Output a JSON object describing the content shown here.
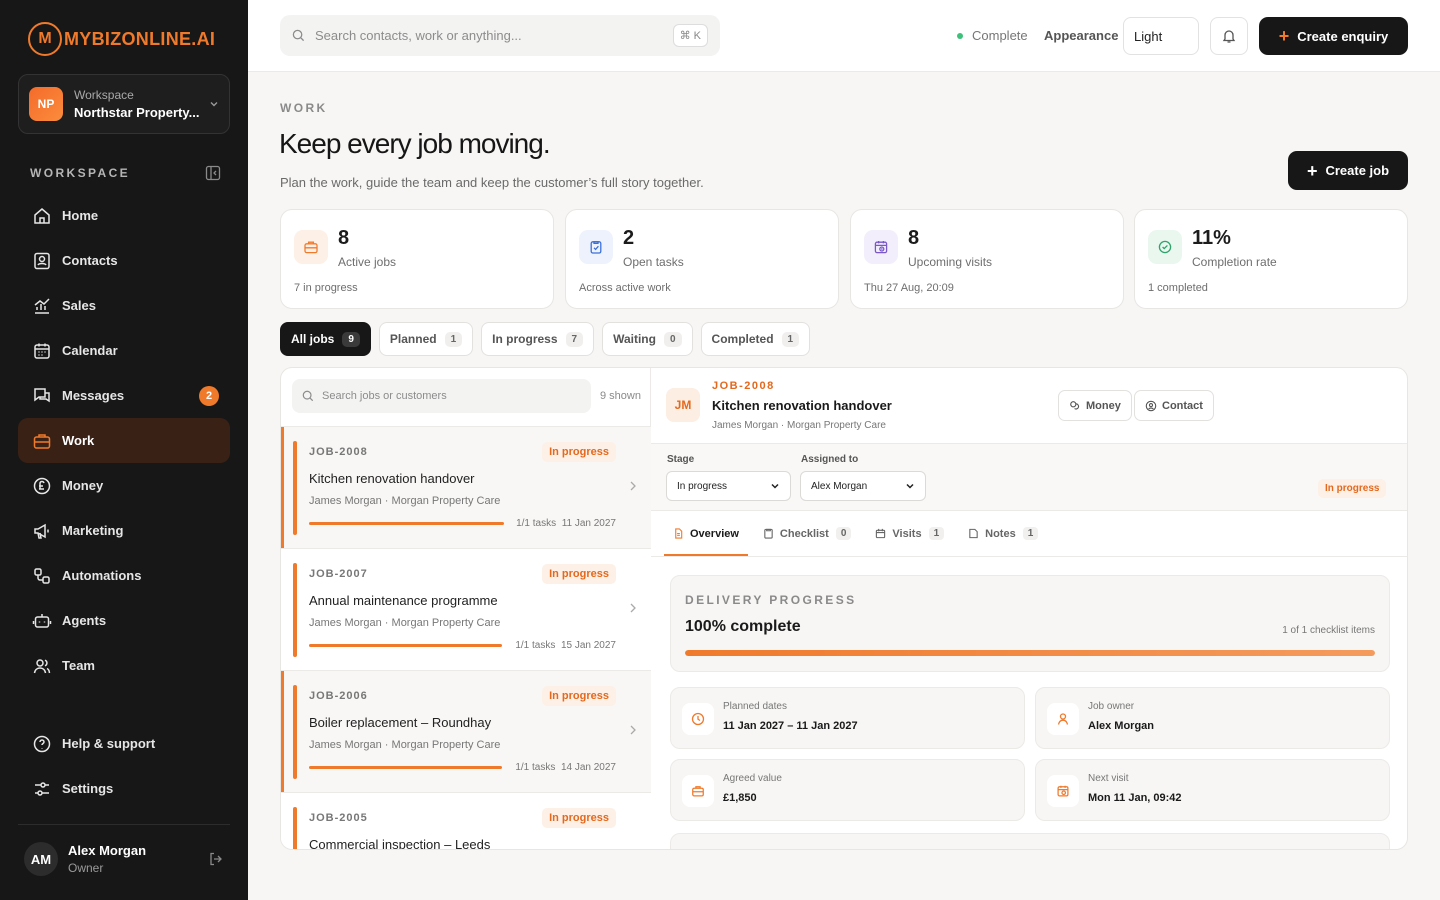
{
  "brand": {
    "logo_letter": "M",
    "name": "MYBIZONLINE.AI",
    "accent": "#f07a2c"
  },
  "workspace": {
    "initials": "NP",
    "label": "Workspace",
    "name": "Northstar Property..."
  },
  "sidebar": {
    "section_label": "WORKSPACE",
    "items": [
      {
        "label": "Home",
        "icon": "home-icon"
      },
      {
        "label": "Contacts",
        "icon": "contacts-icon"
      },
      {
        "label": "Sales",
        "icon": "chart-icon"
      },
      {
        "label": "Calendar",
        "icon": "calendar-icon"
      },
      {
        "label": "Messages",
        "icon": "messages-icon",
        "badge": "2"
      },
      {
        "label": "Work",
        "icon": "briefcase-icon",
        "active": true
      },
      {
        "label": "Money",
        "icon": "pound-icon"
      },
      {
        "label": "Marketing",
        "icon": "megaphone-icon"
      },
      {
        "label": "Automations",
        "icon": "automations-icon"
      },
      {
        "label": "Agents",
        "icon": "robot-icon"
      },
      {
        "label": "Team",
        "icon": "team-icon"
      }
    ],
    "bottom_items": [
      {
        "label": "Help & support",
        "icon": "help-icon"
      },
      {
        "label": "Settings",
        "icon": "settings-icon"
      }
    ]
  },
  "user": {
    "initials": "AM",
    "name": "Alex Morgan",
    "role": "Owner"
  },
  "topbar": {
    "search_placeholder": "Search contacts, work or anything...",
    "shortcut": "⌘ K",
    "status": "Complete",
    "appearance_label": "Appearance",
    "theme_value": "Light",
    "create_enquiry": "Create enquiry"
  },
  "page": {
    "eyebrow": "WORK",
    "title": "Keep every job moving.",
    "subtitle": "Plan the work, guide the team and keep the customer’s full story together.",
    "create_job": "Create job"
  },
  "stats": [
    {
      "value": "8",
      "label": "Active jobs",
      "footer": "7 in progress",
      "icon": "briefcase-icon",
      "color": "#f07a2c",
      "bg": "#fdf0e7"
    },
    {
      "value": "2",
      "label": "Open tasks",
      "footer": "Across active work",
      "icon": "clipboard-icon",
      "color": "#3b6fd8",
      "bg": "#edf2fc"
    },
    {
      "value": "8",
      "label": "Upcoming visits",
      "footer": "Thu 27 Aug, 20:09",
      "icon": "calendar-clock-icon",
      "color": "#7a58c9",
      "bg": "#f2eefb"
    },
    {
      "value": "11%",
      "label": "Completion rate",
      "footer": "1 completed",
      "icon": "check-circle-icon",
      "color": "#2ea36a",
      "bg": "#e9f7ef"
    }
  ],
  "tabs": [
    {
      "label": "All jobs",
      "count": "9",
      "active": true
    },
    {
      "label": "Planned",
      "count": "1"
    },
    {
      "label": "In progress",
      "count": "7"
    },
    {
      "label": "Waiting",
      "count": "0"
    },
    {
      "label": "Completed",
      "count": "1"
    }
  ],
  "job_list": {
    "search_placeholder": "Search jobs or customers",
    "shown": "9 shown",
    "jobs": [
      {
        "id": "JOB-2008",
        "status": "In progress",
        "title": "Kitchen renovation handover",
        "meta": "James Morgan · Morgan Property Care",
        "tasks": "1/1 tasks",
        "date": "11 Jan 2027",
        "progress": 1.0
      },
      {
        "id": "JOB-2007",
        "status": "In progress",
        "title": "Annual maintenance programme",
        "meta": "James Morgan · Morgan Property Care",
        "tasks": "1/1 tasks",
        "date": "15 Jan 2027",
        "progress": 1.0
      },
      {
        "id": "JOB-2006",
        "status": "In progress",
        "title": "Boiler replacement – Roundhay",
        "meta": "James Morgan · Morgan Property Care",
        "tasks": "1/1 tasks",
        "date": "14 Jan 2027",
        "progress": 1.0
      },
      {
        "id": "JOB-2005",
        "status": "In progress",
        "title": "Commercial inspection – Leeds",
        "meta": "",
        "tasks": "",
        "date": "",
        "progress": 1.0
      }
    ]
  },
  "detail": {
    "initials": "JM",
    "id": "JOB-2008",
    "title": "Kitchen renovation handover",
    "meta": "James Morgan · Morgan Property Care",
    "money_btn": "Money",
    "contact_btn": "Contact",
    "stage_label": "Stage",
    "stage_value": "In progress",
    "assigned_label": "Assigned to",
    "assigned_value": "Alex Morgan",
    "status": "In progress",
    "tabs": [
      {
        "label": "Overview",
        "icon": "document-icon",
        "active": true
      },
      {
        "label": "Checklist",
        "count": "0",
        "icon": "clipboard-icon"
      },
      {
        "label": "Visits",
        "count": "1",
        "icon": "calendar-icon"
      },
      {
        "label": "Notes",
        "count": "1",
        "icon": "note-icon"
      }
    ],
    "progress": {
      "eyebrow": "DELIVERY PROGRESS",
      "value_text": "100% complete",
      "count_text": "1 of 1 checklist items",
      "fraction": 1.0
    },
    "info": [
      {
        "label": "Planned dates",
        "value": "11 Jan 2027 – 11 Jan 2027",
        "icon": "clock-icon"
      },
      {
        "label": "Job owner",
        "value": "Alex Morgan",
        "icon": "person-icon"
      },
      {
        "label": "Agreed value",
        "value": "£1,850",
        "icon": "briefcase-icon"
      },
      {
        "label": "Next visit",
        "value": "Mon 11 Jan, 09:42",
        "icon": "calendar-clock-icon"
      }
    ]
  }
}
